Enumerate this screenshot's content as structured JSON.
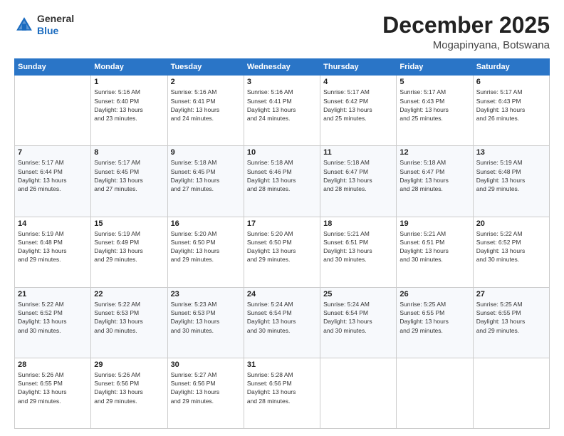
{
  "logo": {
    "general": "General",
    "blue": "Blue"
  },
  "header": {
    "month": "December 2025",
    "location": "Mogapinyana, Botswana"
  },
  "weekdays": [
    "Sunday",
    "Monday",
    "Tuesday",
    "Wednesday",
    "Thursday",
    "Friday",
    "Saturday"
  ],
  "weeks": [
    [
      {
        "day": "",
        "info": ""
      },
      {
        "day": "1",
        "info": "Sunrise: 5:16 AM\nSunset: 6:40 PM\nDaylight: 13 hours\nand 23 minutes."
      },
      {
        "day": "2",
        "info": "Sunrise: 5:16 AM\nSunset: 6:41 PM\nDaylight: 13 hours\nand 24 minutes."
      },
      {
        "day": "3",
        "info": "Sunrise: 5:16 AM\nSunset: 6:41 PM\nDaylight: 13 hours\nand 24 minutes."
      },
      {
        "day": "4",
        "info": "Sunrise: 5:17 AM\nSunset: 6:42 PM\nDaylight: 13 hours\nand 25 minutes."
      },
      {
        "day": "5",
        "info": "Sunrise: 5:17 AM\nSunset: 6:43 PM\nDaylight: 13 hours\nand 25 minutes."
      },
      {
        "day": "6",
        "info": "Sunrise: 5:17 AM\nSunset: 6:43 PM\nDaylight: 13 hours\nand 26 minutes."
      }
    ],
    [
      {
        "day": "7",
        "info": "Sunrise: 5:17 AM\nSunset: 6:44 PM\nDaylight: 13 hours\nand 26 minutes."
      },
      {
        "day": "8",
        "info": "Sunrise: 5:17 AM\nSunset: 6:45 PM\nDaylight: 13 hours\nand 27 minutes."
      },
      {
        "day": "9",
        "info": "Sunrise: 5:18 AM\nSunset: 6:45 PM\nDaylight: 13 hours\nand 27 minutes."
      },
      {
        "day": "10",
        "info": "Sunrise: 5:18 AM\nSunset: 6:46 PM\nDaylight: 13 hours\nand 28 minutes."
      },
      {
        "day": "11",
        "info": "Sunrise: 5:18 AM\nSunset: 6:47 PM\nDaylight: 13 hours\nand 28 minutes."
      },
      {
        "day": "12",
        "info": "Sunrise: 5:18 AM\nSunset: 6:47 PM\nDaylight: 13 hours\nand 28 minutes."
      },
      {
        "day": "13",
        "info": "Sunrise: 5:19 AM\nSunset: 6:48 PM\nDaylight: 13 hours\nand 29 minutes."
      }
    ],
    [
      {
        "day": "14",
        "info": "Sunrise: 5:19 AM\nSunset: 6:48 PM\nDaylight: 13 hours\nand 29 minutes."
      },
      {
        "day": "15",
        "info": "Sunrise: 5:19 AM\nSunset: 6:49 PM\nDaylight: 13 hours\nand 29 minutes."
      },
      {
        "day": "16",
        "info": "Sunrise: 5:20 AM\nSunset: 6:50 PM\nDaylight: 13 hours\nand 29 minutes."
      },
      {
        "day": "17",
        "info": "Sunrise: 5:20 AM\nSunset: 6:50 PM\nDaylight: 13 hours\nand 29 minutes."
      },
      {
        "day": "18",
        "info": "Sunrise: 5:21 AM\nSunset: 6:51 PM\nDaylight: 13 hours\nand 30 minutes."
      },
      {
        "day": "19",
        "info": "Sunrise: 5:21 AM\nSunset: 6:51 PM\nDaylight: 13 hours\nand 30 minutes."
      },
      {
        "day": "20",
        "info": "Sunrise: 5:22 AM\nSunset: 6:52 PM\nDaylight: 13 hours\nand 30 minutes."
      }
    ],
    [
      {
        "day": "21",
        "info": "Sunrise: 5:22 AM\nSunset: 6:52 PM\nDaylight: 13 hours\nand 30 minutes."
      },
      {
        "day": "22",
        "info": "Sunrise: 5:22 AM\nSunset: 6:53 PM\nDaylight: 13 hours\nand 30 minutes."
      },
      {
        "day": "23",
        "info": "Sunrise: 5:23 AM\nSunset: 6:53 PM\nDaylight: 13 hours\nand 30 minutes."
      },
      {
        "day": "24",
        "info": "Sunrise: 5:24 AM\nSunset: 6:54 PM\nDaylight: 13 hours\nand 30 minutes."
      },
      {
        "day": "25",
        "info": "Sunrise: 5:24 AM\nSunset: 6:54 PM\nDaylight: 13 hours\nand 30 minutes."
      },
      {
        "day": "26",
        "info": "Sunrise: 5:25 AM\nSunset: 6:55 PM\nDaylight: 13 hours\nand 29 minutes."
      },
      {
        "day": "27",
        "info": "Sunrise: 5:25 AM\nSunset: 6:55 PM\nDaylight: 13 hours\nand 29 minutes."
      }
    ],
    [
      {
        "day": "28",
        "info": "Sunrise: 5:26 AM\nSunset: 6:55 PM\nDaylight: 13 hours\nand 29 minutes."
      },
      {
        "day": "29",
        "info": "Sunrise: 5:26 AM\nSunset: 6:56 PM\nDaylight: 13 hours\nand 29 minutes."
      },
      {
        "day": "30",
        "info": "Sunrise: 5:27 AM\nSunset: 6:56 PM\nDaylight: 13 hours\nand 29 minutes."
      },
      {
        "day": "31",
        "info": "Sunrise: 5:28 AM\nSunset: 6:56 PM\nDaylight: 13 hours\nand 28 minutes."
      },
      {
        "day": "",
        "info": ""
      },
      {
        "day": "",
        "info": ""
      },
      {
        "day": "",
        "info": ""
      }
    ]
  ]
}
